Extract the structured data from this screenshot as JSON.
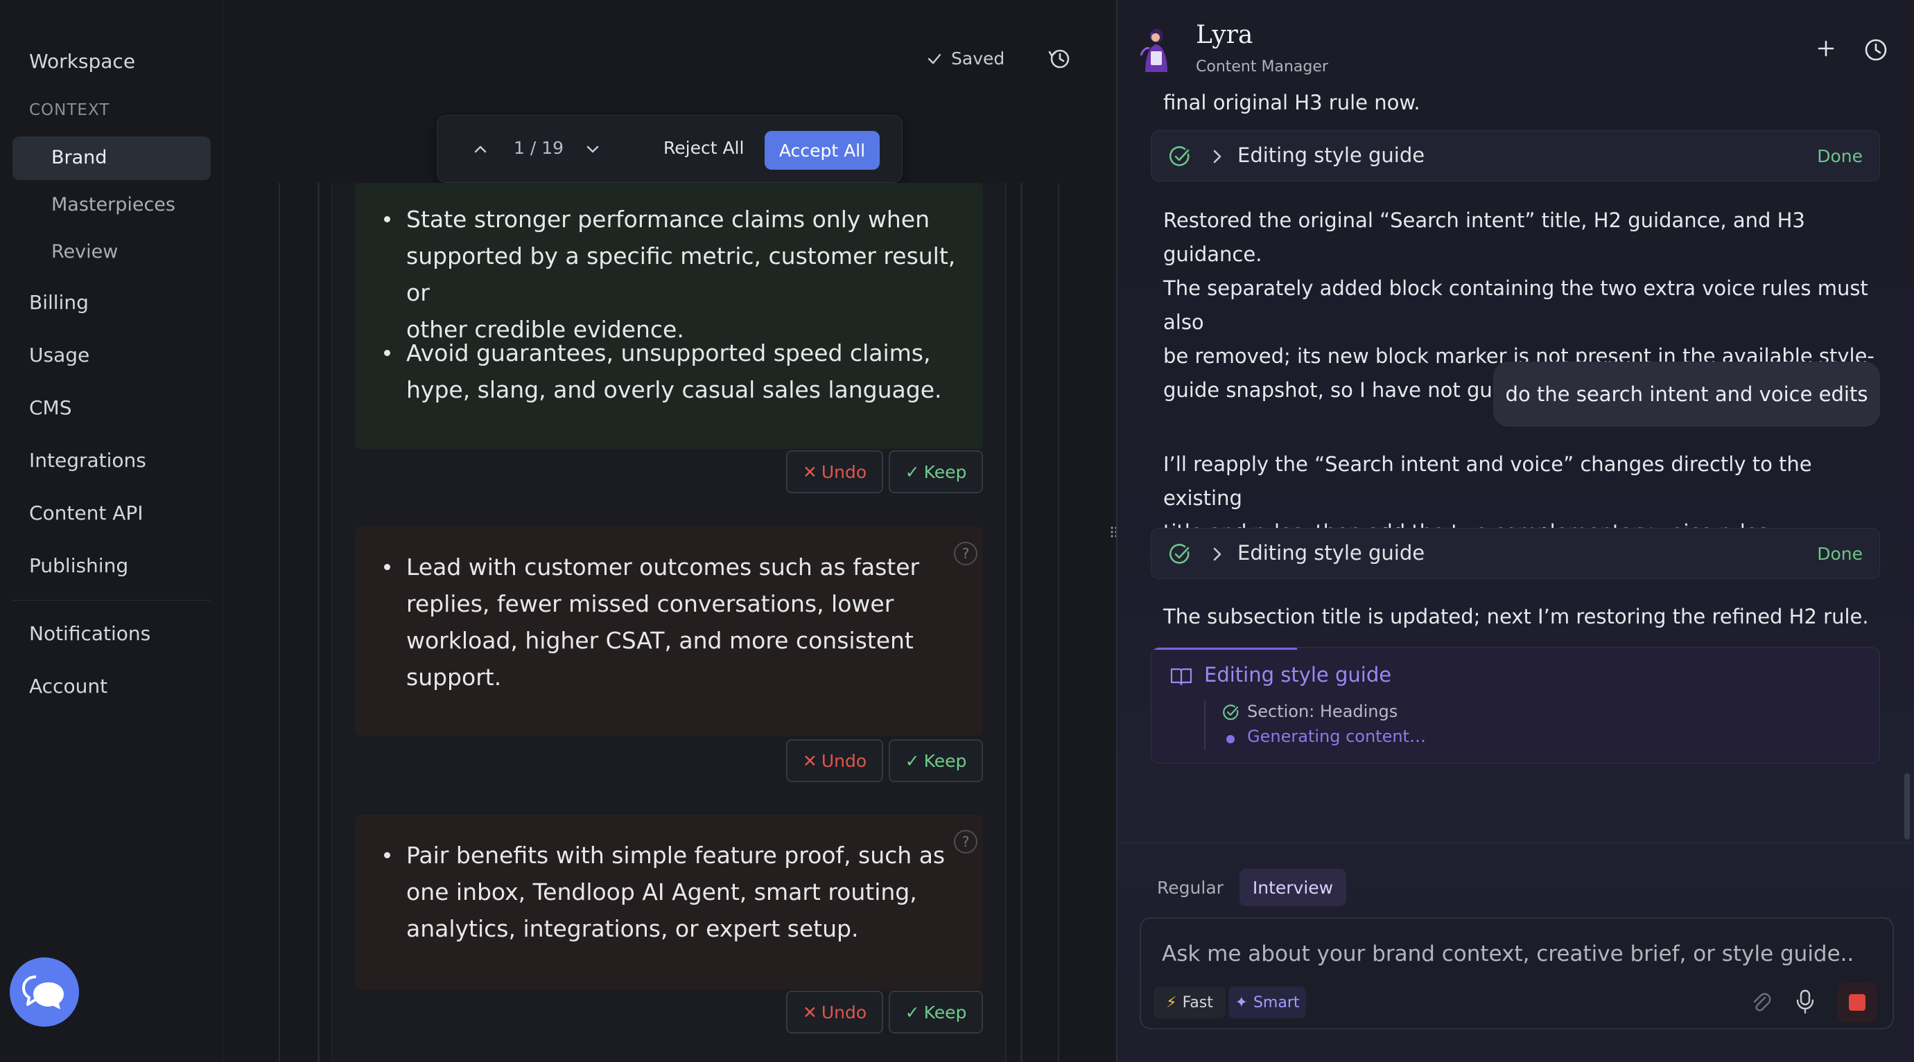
{
  "sidebar": {
    "workspace": "Workspace",
    "context_label": "CONTEXT",
    "context_items": [
      {
        "label": "Brand",
        "active": true
      },
      {
        "label": "Masterpieces"
      },
      {
        "label": "Review"
      }
    ],
    "items": [
      {
        "label": "Billing"
      },
      {
        "label": "Usage"
      },
      {
        "label": "CMS"
      },
      {
        "label": "Integrations"
      },
      {
        "label": "Content API"
      },
      {
        "label": "Publishing"
      }
    ],
    "footer_items": [
      {
        "label": "Notifications"
      },
      {
        "label": "Account"
      }
    ]
  },
  "editor": {
    "saved_label": "Saved",
    "toolbar": {
      "count": "1 / 19",
      "reject_all": "Reject All",
      "accept_all": "Accept All"
    },
    "blocks": [
      {
        "kind": "added",
        "bullets": [
          [
            "State stronger performance claims only when",
            "supported by a specific metric, customer result, or",
            "other credible evidence."
          ],
          [
            "Avoid guarantees, unsupported speed claims,",
            "hype, slang, and overly casual sales language."
          ]
        ]
      },
      {
        "kind": "removed",
        "bullets": [
          [
            "Lead with customer outcomes such as faster",
            "replies, fewer missed conversations, lower",
            "workload, higher CSAT, and more consistent",
            "support."
          ]
        ]
      },
      {
        "kind": "removed",
        "bullets": [
          [
            "Pair benefits with simple feature proof, such as",
            "one inbox, Tendloop AI Agent, smart routing,",
            "analytics, integrations, or expert setup."
          ]
        ]
      }
    ],
    "undo_label": "Undo",
    "keep_label": "Keep",
    "help_label": "?"
  },
  "assistant": {
    "name": "Lyra",
    "role": "Content Manager",
    "messages": {
      "top_fragment": "final original H3 rule now.",
      "tool1": {
        "label": "Editing style guide",
        "status": "Done"
      },
      "restored_text": [
        "Restored the original “Search intent” title, H2 guidance, and H3 guidance.",
        "The separately added block containing the two extra voice rules must also",
        "be removed; its new block marker is not present in the available style-",
        "guide snapshot, so I have not guessed or targeted the wrong block."
      ],
      "user_msg": "do the search intent and voice edits",
      "reapply_text": [
        "I’ll reapply the “Search intent and voice” changes directly to the existing",
        "title and rules, then add the two complementary voice rules."
      ],
      "tool2": {
        "label": "Editing style guide",
        "status": "Done"
      },
      "subsection_text": "The subsection title is updated; next I’m restoring the refined H2 rule.",
      "generating": {
        "title": "Editing style guide",
        "section": "Section: Headings",
        "status": "Generating content…"
      }
    },
    "composer": {
      "tabs": {
        "regular": "Regular",
        "interview": "Interview"
      },
      "active_tab": "Interview",
      "placeholder": "Ask me about your brand context, creative brief, or style guide...",
      "fast": "Fast",
      "smart": "Smart"
    }
  },
  "colors": {
    "accent_blue": "#5878e6",
    "success_green": "#6cc58a",
    "danger_red": "#e0564b",
    "purple": "#9d88f2"
  }
}
